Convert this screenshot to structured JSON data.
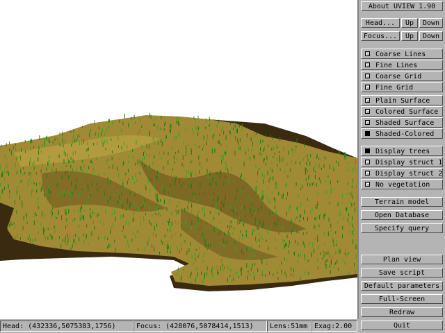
{
  "viewport": {
    "background": "#ffffff",
    "terrain_colors": {
      "soil": "#a08a35",
      "soil_dark": "#6e5a1e",
      "shadow": "#3a2a10",
      "tree": "#1f7a12",
      "tree_light": "#3aa021"
    }
  },
  "panel": {
    "about_label": "About UVIEW 1.90",
    "head": {
      "label": "Head...",
      "up": "Up",
      "down": "Down"
    },
    "focus": {
      "label": "Focus...",
      "up": "Up",
      "down": "Down"
    },
    "line_options": [
      {
        "label": "Coarse Lines",
        "checked": false
      },
      {
        "label": "Fine Lines",
        "checked": false
      },
      {
        "label": "Coarse Grid",
        "checked": false
      },
      {
        "label": "Fine Grid",
        "checked": false
      }
    ],
    "surface_options": [
      {
        "label": "Plain Surface",
        "checked": false
      },
      {
        "label": "Colored Surface",
        "checked": false
      },
      {
        "label": "Shaded Surface",
        "checked": false
      },
      {
        "label": "Shaded-Colored",
        "checked": true
      }
    ],
    "vegetation_options": [
      {
        "label": "Display trees",
        "checked": true
      },
      {
        "label": "Display struct 1",
        "checked": false
      },
      {
        "label": "Display struct 2",
        "checked": false
      },
      {
        "label": "No vegetation",
        "checked": false
      }
    ],
    "terrain_model": "Terrain model",
    "open_database": "Open Database",
    "specify_query": "Specify query",
    "plan_view": "Plan view",
    "save_script": "Save script",
    "default_parameters": "Default parameters",
    "full_screen": "Full-Screen",
    "redraw": "Redraw",
    "quit": "Quit"
  },
  "status_bar": {
    "head_label": "Head:",
    "head_value": "(432336,5075383,1756)",
    "focus_label": "Focus:",
    "focus_value": "(428076,5078414,1513)",
    "lens_label": "Lens:",
    "lens_value": "51mm",
    "exag_label": "Exag:",
    "exag_value": "2.00"
  }
}
